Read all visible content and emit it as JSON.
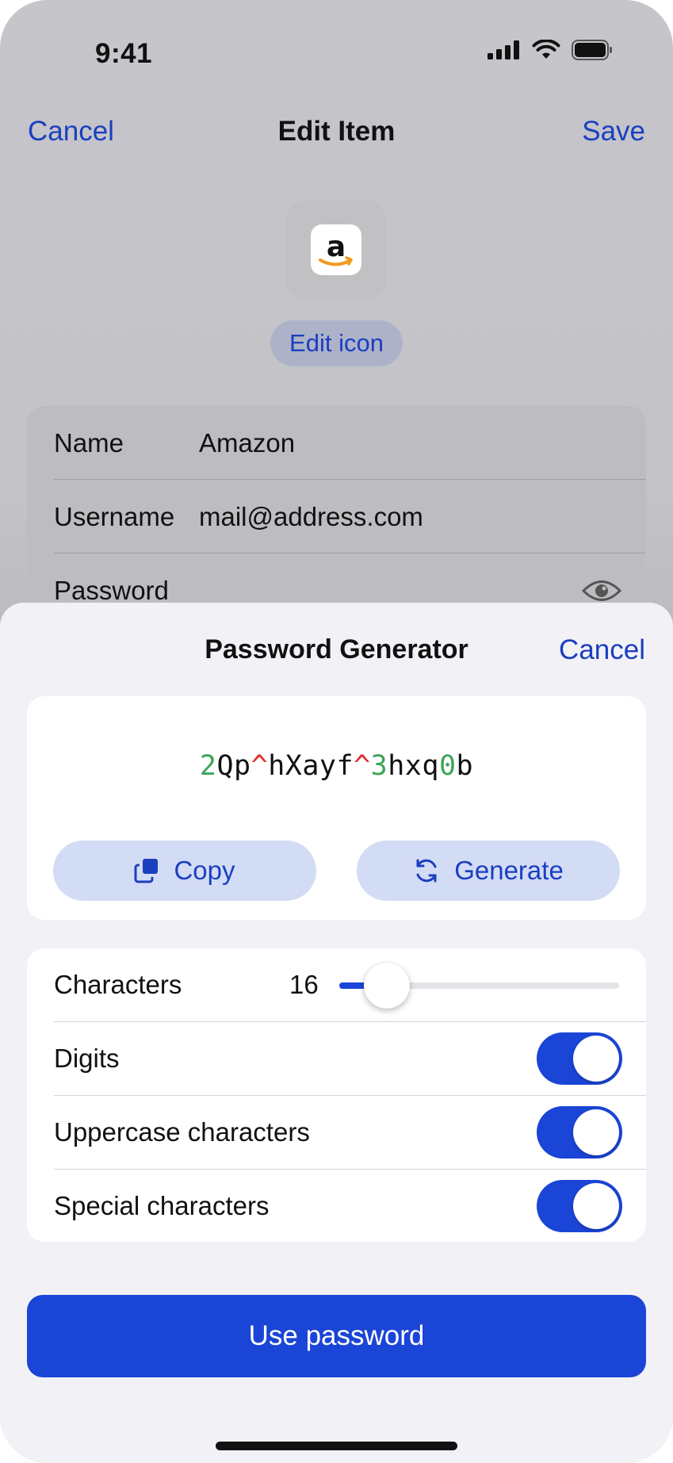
{
  "status": {
    "time": "9:41"
  },
  "nav": {
    "cancel": "Cancel",
    "title": "Edit Item",
    "save": "Save"
  },
  "item": {
    "icon": "amazon-logo",
    "edit_icon_label": "Edit icon",
    "fields": [
      {
        "label": "Name",
        "value": "Amazon"
      },
      {
        "label": "Username",
        "value": "mail@address.com"
      },
      {
        "label": "Password",
        "value": ""
      }
    ]
  },
  "generator": {
    "title": "Password Generator",
    "cancel": "Cancel",
    "password_segments": [
      {
        "text": "2",
        "type": "digit"
      },
      {
        "text": "Qp",
        "type": "letter"
      },
      {
        "text": "^",
        "type": "special"
      },
      {
        "text": "hXayf",
        "type": "letter"
      },
      {
        "text": "^",
        "type": "special"
      },
      {
        "text": "3",
        "type": "digit"
      },
      {
        "text": "hxq",
        "type": "letter"
      },
      {
        "text": "0",
        "type": "digit"
      },
      {
        "text": "b",
        "type": "letter"
      }
    ],
    "copy_label": "Copy",
    "generate_label": "Generate",
    "characters_label": "Characters",
    "characters_count": "16",
    "slider_fraction": 0.17,
    "options": [
      {
        "label": "Digits",
        "enabled": true
      },
      {
        "label": "Uppercase characters",
        "enabled": true
      },
      {
        "label": "Special characters",
        "enabled": true
      }
    ],
    "use_label": "Use password"
  },
  "colors": {
    "accent": "#1a45d6",
    "digit": "#3da458",
    "special": "#e02a2a",
    "link": "#1a3fbf"
  }
}
